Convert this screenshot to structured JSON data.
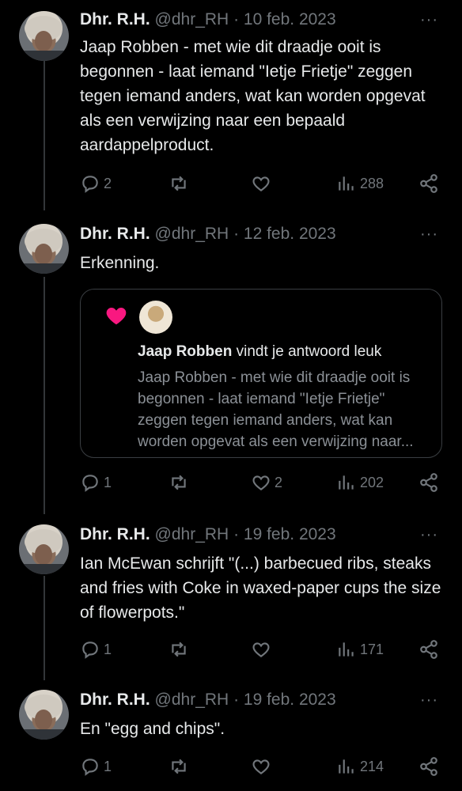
{
  "tweets": [
    {
      "name": "Dhr. R.H.",
      "handle": "@dhr_RH",
      "date": "· 10 feb. 2023",
      "more": "···",
      "text": "Jaap Robben - met wie dit draadje ooit is begonnen - laat iemand \"Ietje Frietje\" zeggen tegen iemand anders, wat kan worden opgevat als een verwijzing naar een bepaald aardappelproduct.",
      "replies": "2",
      "retweets": "",
      "likes": "",
      "views": "288"
    },
    {
      "name": "Dhr. R.H.",
      "handle": "@dhr_RH",
      "date": "· 12 feb. 2023",
      "more": "···",
      "text": "Erkenning.",
      "replies": "1",
      "retweets": "",
      "likes": "2",
      "views": "202",
      "quote": {
        "liker": "Jaap Robben",
        "liked_text": " vindt je antwoord leuk",
        "body": "Jaap Robben - met wie dit draadje ooit is begonnen - laat iemand \"Ietje Frietje\" zeggen tegen iemand anders, wat kan worden opgevat als een verwijzing naar..."
      }
    },
    {
      "name": "Dhr. R.H.",
      "handle": "@dhr_RH",
      "date": "· 19 feb. 2023",
      "more": "···",
      "text": "Ian McEwan schrijft \"(...) barbecued ribs, steaks and fries with Coke in waxed-paper cups the size of flowerpots.\"",
      "replies": "1",
      "retweets": "",
      "likes": "",
      "views": "171"
    },
    {
      "name": "Dhr. R.H.",
      "handle": "@dhr_RH",
      "date": "· 19 feb. 2023",
      "more": "···",
      "text": "En \"egg and chips\".",
      "replies": "1",
      "retweets": "",
      "likes": "",
      "views": "214"
    }
  ],
  "colors": {
    "background": "#000000",
    "text": "#e7e9ea",
    "muted": "#71767b",
    "like_pink": "#f91880"
  },
  "icons": [
    "reply-icon",
    "retweet-icon",
    "like-icon",
    "views-icon",
    "share-icon",
    "more-icon"
  ]
}
